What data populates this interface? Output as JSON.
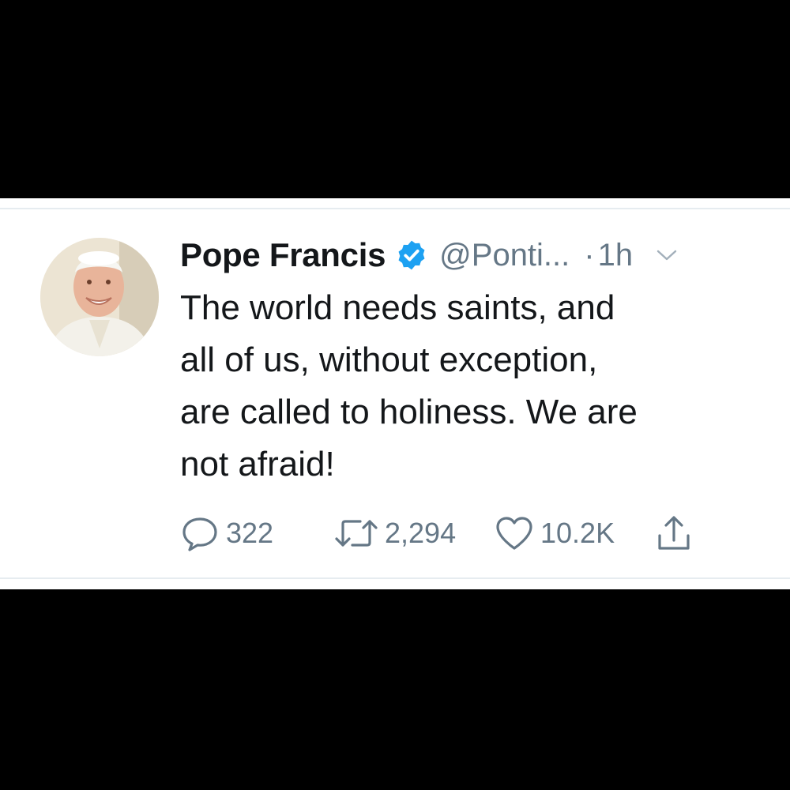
{
  "tweet": {
    "author": {
      "name": "Pope Francis",
      "handle": "@Ponti...",
      "verified": true,
      "verified_icon": "verified-badge-icon",
      "avatar": "avatar"
    },
    "time_separator": "·",
    "timestamp": "1h",
    "text_lines": [
      "The world needs saints, and",
      "all of us, without exception,",
      "are called to holiness. We are",
      "not afraid!"
    ],
    "actions": {
      "replies": "322",
      "retweets": "2,294",
      "likes": "10.2K"
    }
  },
  "colors": {
    "background": "#000000",
    "card": "#ffffff",
    "text": "#14171a",
    "secondary_text": "#657786",
    "verified_blue": "#1da1f2",
    "divider": "#e6ecf0"
  },
  "icons": {
    "reply": "reply-bubble-icon",
    "retweet": "retweet-icon",
    "like": "heart-icon",
    "share": "share-icon",
    "menu": "chevron-down-icon"
  }
}
